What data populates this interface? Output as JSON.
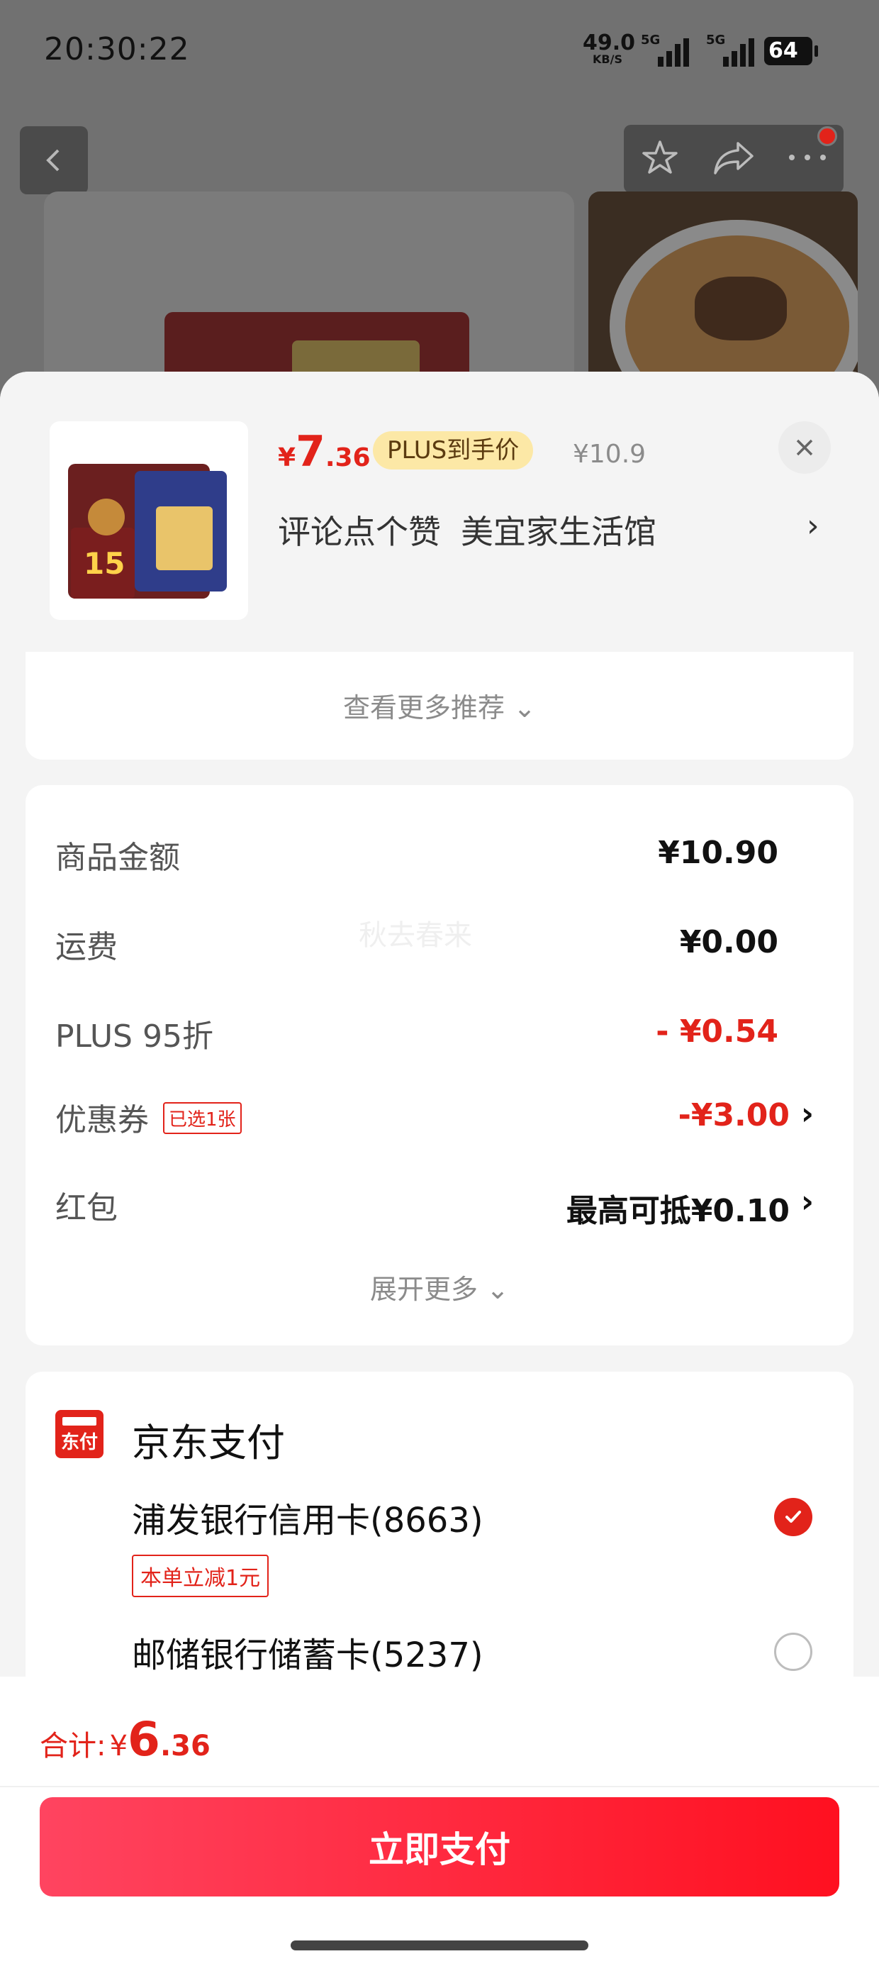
{
  "status_bar": {
    "time": "20:30:22",
    "net_speed": "49.0",
    "net_unit": "KB/S",
    "signal_1_label": "5G",
    "signal_2_label": "5G",
    "battery": "64"
  },
  "product": {
    "price_symbol": "¥",
    "price_int": "7",
    "price_dec": ".36",
    "plus_tag": "PLUS到手价",
    "original_price": "¥10.9",
    "review_text": "评论点个赞",
    "shop_name": "美宜家生活馆",
    "arrow": "›",
    "pack_text": "15"
  },
  "more_recommend": "查看更多推荐 ⌄",
  "costs": {
    "rows": [
      {
        "label": "商品金额",
        "value": "¥10.90"
      },
      {
        "label": "运费",
        "value": "¥0.00"
      },
      {
        "label": "PLUS 95折",
        "value": "- ¥0.54"
      },
      {
        "label": "优惠券",
        "badge": "已选1张",
        "value": "-¥3.00",
        "chev": "›"
      },
      {
        "label": "红包",
        "value": "最高可抵¥0.10",
        "chev": "›"
      }
    ],
    "watermark": "秋去春来",
    "expand": "展开更多 ⌄"
  },
  "payment": {
    "logo_text": "东付",
    "title": "京东支付",
    "options": [
      {
        "name": "浦发银行信用卡(8663)",
        "tag": "本单立减1元",
        "selected": true
      },
      {
        "name": "邮储银行储蓄卡(5237)",
        "selected": false
      }
    ]
  },
  "footer": {
    "total_label": "合计:",
    "total_symbol": "¥",
    "total_int": "6",
    "total_dec": ".36",
    "pay_button": "立即支付"
  },
  "colors": {
    "accent_red": "#e2231a",
    "plus_gold": "#fce8a6",
    "button_gradient_start": "#ff4460",
    "button_gradient_end": "#ff1020"
  }
}
